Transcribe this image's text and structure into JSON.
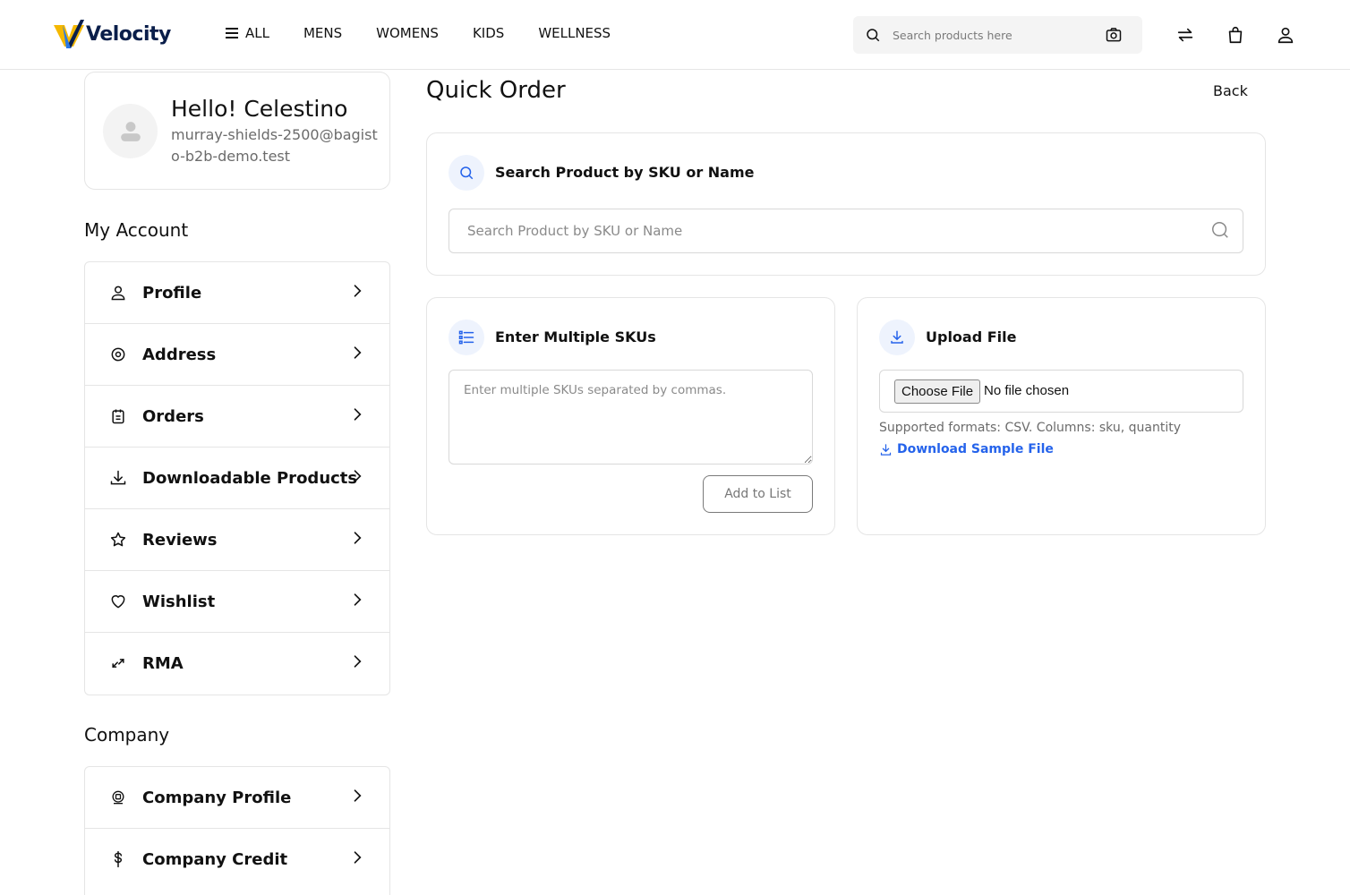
{
  "brand": {
    "name": "Velocity",
    "accent": "#f5b800",
    "navy": "#0a1e4a"
  },
  "header": {
    "nav": [
      "ALL",
      "MENS",
      "WOMENS",
      "KIDS",
      "WELLNESS"
    ],
    "search_placeholder": "Search products here",
    "icons": [
      "compare-icon",
      "cart-icon",
      "user-icon"
    ]
  },
  "profile": {
    "greeting": "Hello! Celestino",
    "email": "murray-shields-2500@bagisto-b2b-demo.test"
  },
  "account": {
    "title": "My Account",
    "items": [
      {
        "label": "Profile",
        "icon": "user-icon"
      },
      {
        "label": "Address",
        "icon": "location-icon"
      },
      {
        "label": "Orders",
        "icon": "orders-icon"
      },
      {
        "label": "Downloadable Products",
        "icon": "download-icon"
      },
      {
        "label": "Reviews",
        "icon": "star-icon"
      },
      {
        "label": "Wishlist",
        "icon": "heart-icon"
      },
      {
        "label": "RMA",
        "icon": "rma-icon"
      }
    ]
  },
  "company": {
    "title": "Company",
    "items": [
      {
        "label": "Company Profile",
        "icon": "company-icon"
      },
      {
        "label": "Company Credit",
        "icon": "dollar-icon"
      }
    ]
  },
  "main": {
    "title": "Quick Order",
    "back": "Back",
    "search_section": {
      "title": "Search Product by SKU or Name",
      "placeholder": "Search Product by SKU or Name"
    },
    "multi_section": {
      "title": "Enter Multiple SKUs",
      "placeholder": "Enter multiple SKUs separated by commas.",
      "button": "Add to List"
    },
    "upload_section": {
      "title": "Upload File",
      "choose": "Choose File",
      "no_file": "No file chosen",
      "formats": "Supported formats: CSV. Columns: sku, quantity",
      "download": "Download Sample File"
    }
  }
}
